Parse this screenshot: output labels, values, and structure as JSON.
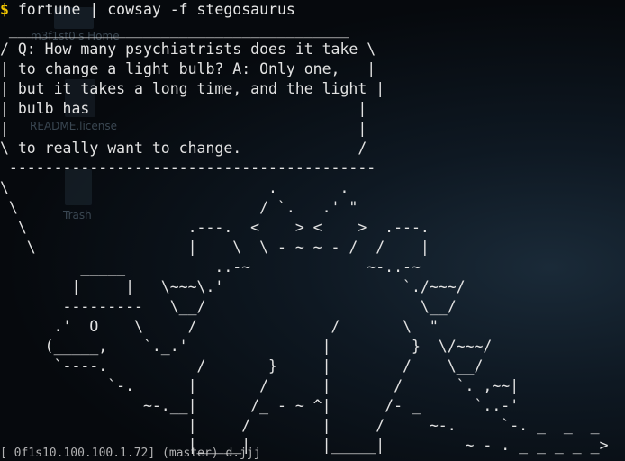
{
  "desktop": {
    "icons": [
      {
        "label": "m3f1st0's Home",
        "icon": "folder-home-icon"
      },
      {
        "label": "README.license",
        "icon": "text-file-icon"
      },
      {
        "label": "Trash",
        "icon": "trash-icon"
      }
    ]
  },
  "terminal": {
    "prompt_symbol": "$",
    "command": "fortune | cowsay -f stegosaurus",
    "output": " ______________________________________\n/ Q: How many psychiatrists does it take \\\n| to change a light bulb? A: Only one,   |\n| but it takes a long time, and the light |\n| bulb has                              |\n|                                       |\n\\ to really want to change.             /\n -----------------------------------------\n\\                             .       .\n \\                           / `.   .' \"\n  \\                  .---.  <    > <    >  .---.\n   \\                 |    \\  \\ - ~ ~ - /  /    |\n         _____          ..-~             ~-..-~\n        |     |   \\~~~\\.'                    `./~~~/\n       ---------   \\__/                        \\__/\n      .'  O    \\     /               /       \\  \"\n     (_____,    `._.'               |         }  \\/~~~/\n      `----.          /       }     |        /    \\__/\n            `-.      |       /      |       /      `. ,~~|\n                ~-.__|      /_ - ~ ^|      /- _      `..-'\n                     |     /        |     /     ~-.     `-. _  _  _\n                     |_____|        |_____|         ~ - . _ _ _ _ _>",
    "status_line": "[ 0f1s10.100.100.1.72] (master) d.jjj"
  }
}
